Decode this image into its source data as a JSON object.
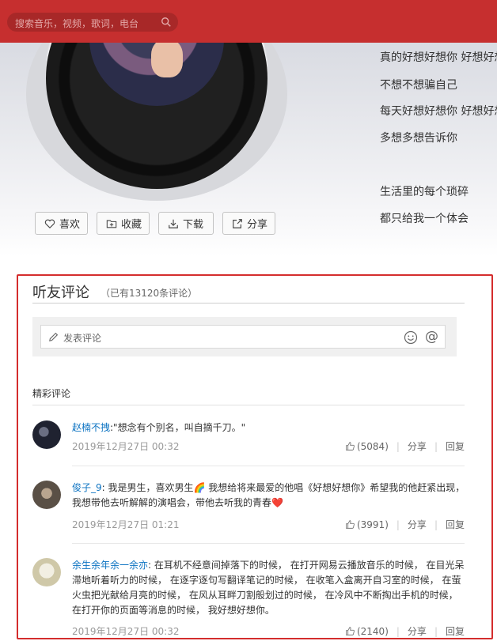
{
  "header": {
    "search_placeholder": "搜索音乐，视频，歌词，电台"
  },
  "lyrics": [
    "真的好想好想你 好想好想",
    "不想不想骗自己",
    "每天好想好想你 好想好想",
    "多想多想告诉你",
    "",
    "生活里的每个琐碎",
    "都只给我一个体会"
  ],
  "actions": {
    "like": "喜欢",
    "collect": "收藏",
    "download": "下载",
    "share": "分享"
  },
  "comments": {
    "title": "听友评论",
    "count": "（已有13120条评论）",
    "input_placeholder": "发表评论",
    "hot_title": "精彩评论",
    "items": [
      {
        "user": "赵楠不拽",
        "text": ":\"想念有个别名，叫自摘千刀。\"",
        "time": "2019年12月27日 00:32",
        "likes": "(5084)",
        "share": "分享",
        "reply": "回复"
      },
      {
        "user": "俊子_9",
        "text": ": 我是男生，喜欢男生🌈 我想给将来最爱的他唱《好想好想你》希望我的他赶紧出现，我想带他去听解解的演唱会，带他去听我的青春❤️",
        "time": "2019年12月27日 01:21",
        "likes": "(3991)",
        "share": "分享",
        "reply": "回复"
      },
      {
        "user": "余生余年余一余亦",
        "text": ": 在耳机不经意间掉落下的时候，  在打开网易云播放音乐的时候，  在目光呆滞地听着听力的时候，  在逐字逐句写翻译笔记的时候，  在收笔入盒离开自习室的时候，  在萤火虫把光献给月亮的时候，  在风从耳畔刀割般划过的时候，  在冷风中不断掏出手机的时候，  在打开你的页面等消息的时候，  我好想好想你。",
        "time": "2019年12月27日 00:32",
        "likes": "(2140)",
        "share": "分享",
        "reply": "回复"
      }
    ]
  },
  "colors": {
    "brand_red": "#c62f2f",
    "link_blue": "#0c73c2",
    "highlight_border": "#d42d2d"
  }
}
